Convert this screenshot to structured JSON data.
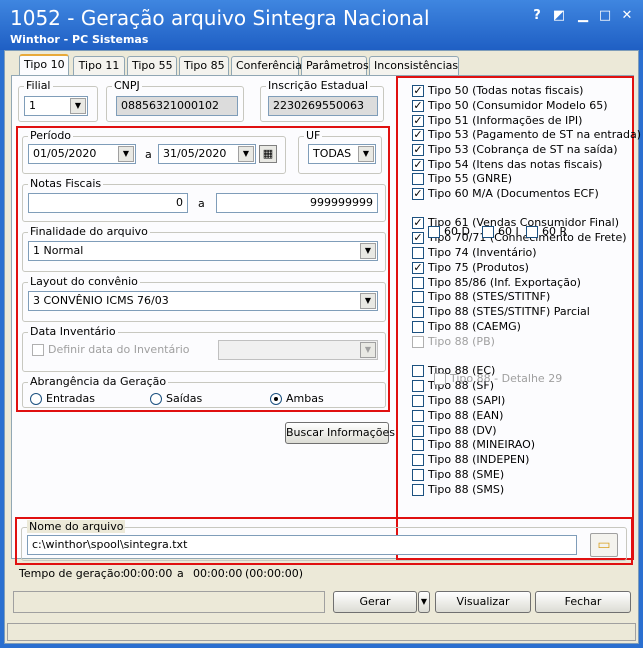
{
  "window": {
    "title": "1052 - Geração arquivo Sintegra Nacional",
    "subtitle": "Winthor - PC Sistemas",
    "help_glyph": "?",
    "minimize_glyph": "▁",
    "maximize_glyph": "□",
    "close_glyph": "✕"
  },
  "tabs": [
    {
      "label": "Tipo 10"
    },
    {
      "label": "Tipo 11"
    },
    {
      "label": "Tipo 55"
    },
    {
      "label": "Tipo 85"
    },
    {
      "label": "Conferência"
    },
    {
      "label": "Parâmetros"
    },
    {
      "label": "Inconsistências"
    }
  ],
  "filial": {
    "label": "Filial",
    "value": "1"
  },
  "cnpj": {
    "label": "CNPJ",
    "value": "08856321000102"
  },
  "inscricao": {
    "label": "Inscrição Estadual",
    "value": "2230269550063"
  },
  "periodo": {
    "label": "Período",
    "start": "01/05/2020",
    "sep": "a",
    "end": "31/05/2020"
  },
  "uf": {
    "label": "UF",
    "value": "TODAS"
  },
  "notas": {
    "label": "Notas Fiscais",
    "start": "0",
    "sep": "a",
    "end": "999999999"
  },
  "finalidade": {
    "label": "Finalidade do arquivo",
    "value": "1 Normal"
  },
  "layout": {
    "label": "Layout do convênio",
    "value": "3 CONVÊNIO ICMS 76/03"
  },
  "inventario": {
    "label": "Data Inventário",
    "checkbox_label": "Definir data do Inventário"
  },
  "abrangencia": {
    "label": "Abrangência da Geração",
    "options": [
      "Entradas",
      "Saídas",
      "Ambas"
    ],
    "selected": "Ambas"
  },
  "buscar_label": "Buscar Informações",
  "tipos": [
    {
      "label": "Tipo 50 (Todas notas fiscais)",
      "checked": true
    },
    {
      "label": "Tipo 50 (Consumidor Modelo 65)",
      "checked": true
    },
    {
      "label": "Tipo 51 (Informações de IPI)",
      "checked": true
    },
    {
      "label": "Tipo 53 (Pagamento de ST na entrada)",
      "checked": true
    },
    {
      "label": "Tipo 53 (Cobrança de ST na saída)",
      "checked": true
    },
    {
      "label": "Tipo 54 (Itens das notas fiscais)",
      "checked": true
    },
    {
      "label": "Tipo 55 (GNRE)",
      "checked": false
    },
    {
      "label": "Tipo 60 M/A (Documentos ECF)",
      "checked": true
    },
    {
      "label": "Tipo 61 (Vendas Consumidor Final)",
      "checked": true
    },
    {
      "label": "Tipo 70/71 (Conhecimento de Frete)",
      "checked": true
    },
    {
      "label": "Tipo 74 (Inventário)",
      "checked": false
    },
    {
      "label": "Tipo 75 (Produtos)",
      "checked": true
    },
    {
      "label": "Tipo 85/86 (Inf. Exportação)",
      "checked": false
    },
    {
      "label": "Tipo 88 (STES/STITNF)",
      "checked": false
    },
    {
      "label": "Tipo 88 (STES/STITNF) Parcial",
      "checked": false
    },
    {
      "label": "Tipo 88 (CAEMG)",
      "checked": false
    },
    {
      "label": "Tipo 88 (PB)",
      "checked": false
    },
    {
      "label": "Tipo 88 (EC)",
      "checked": false
    },
    {
      "label": "Tipo 88 (SF)",
      "checked": false
    },
    {
      "label": "Tipo 88 (SAPI)",
      "checked": false
    },
    {
      "label": "Tipo 88 (EAN)",
      "checked": false
    },
    {
      "label": "Tipo 88 (DV)",
      "checked": false
    },
    {
      "label": "Tipo 88 (MINEIRAO)",
      "checked": false
    },
    {
      "label": "Tipo 88 (INDEPEN)",
      "checked": false
    },
    {
      "label": "Tipo 88 (SME)",
      "checked": false
    },
    {
      "label": "Tipo 88 (SMS)",
      "checked": false
    }
  ],
  "sub60": [
    "60 D",
    "60 I",
    "60 R"
  ],
  "detalhe29": "Tipo 88 - Detalhe 29",
  "arquivo": {
    "label": "Nome do arquivo",
    "value": "c:\\winthor\\spool\\sintegra.txt"
  },
  "tempo": {
    "label": "Tempo de geração:",
    "start": "00:00:00",
    "sep": "a",
    "end": "00:00:00",
    "total": "(00:00:00)"
  },
  "buttons": {
    "gerar": "Gerar",
    "visualizar": "Visualizar",
    "fechar": "Fechar"
  },
  "colors": {
    "highlight": "#e01010",
    "title_bar": "#2a6fd0"
  }
}
